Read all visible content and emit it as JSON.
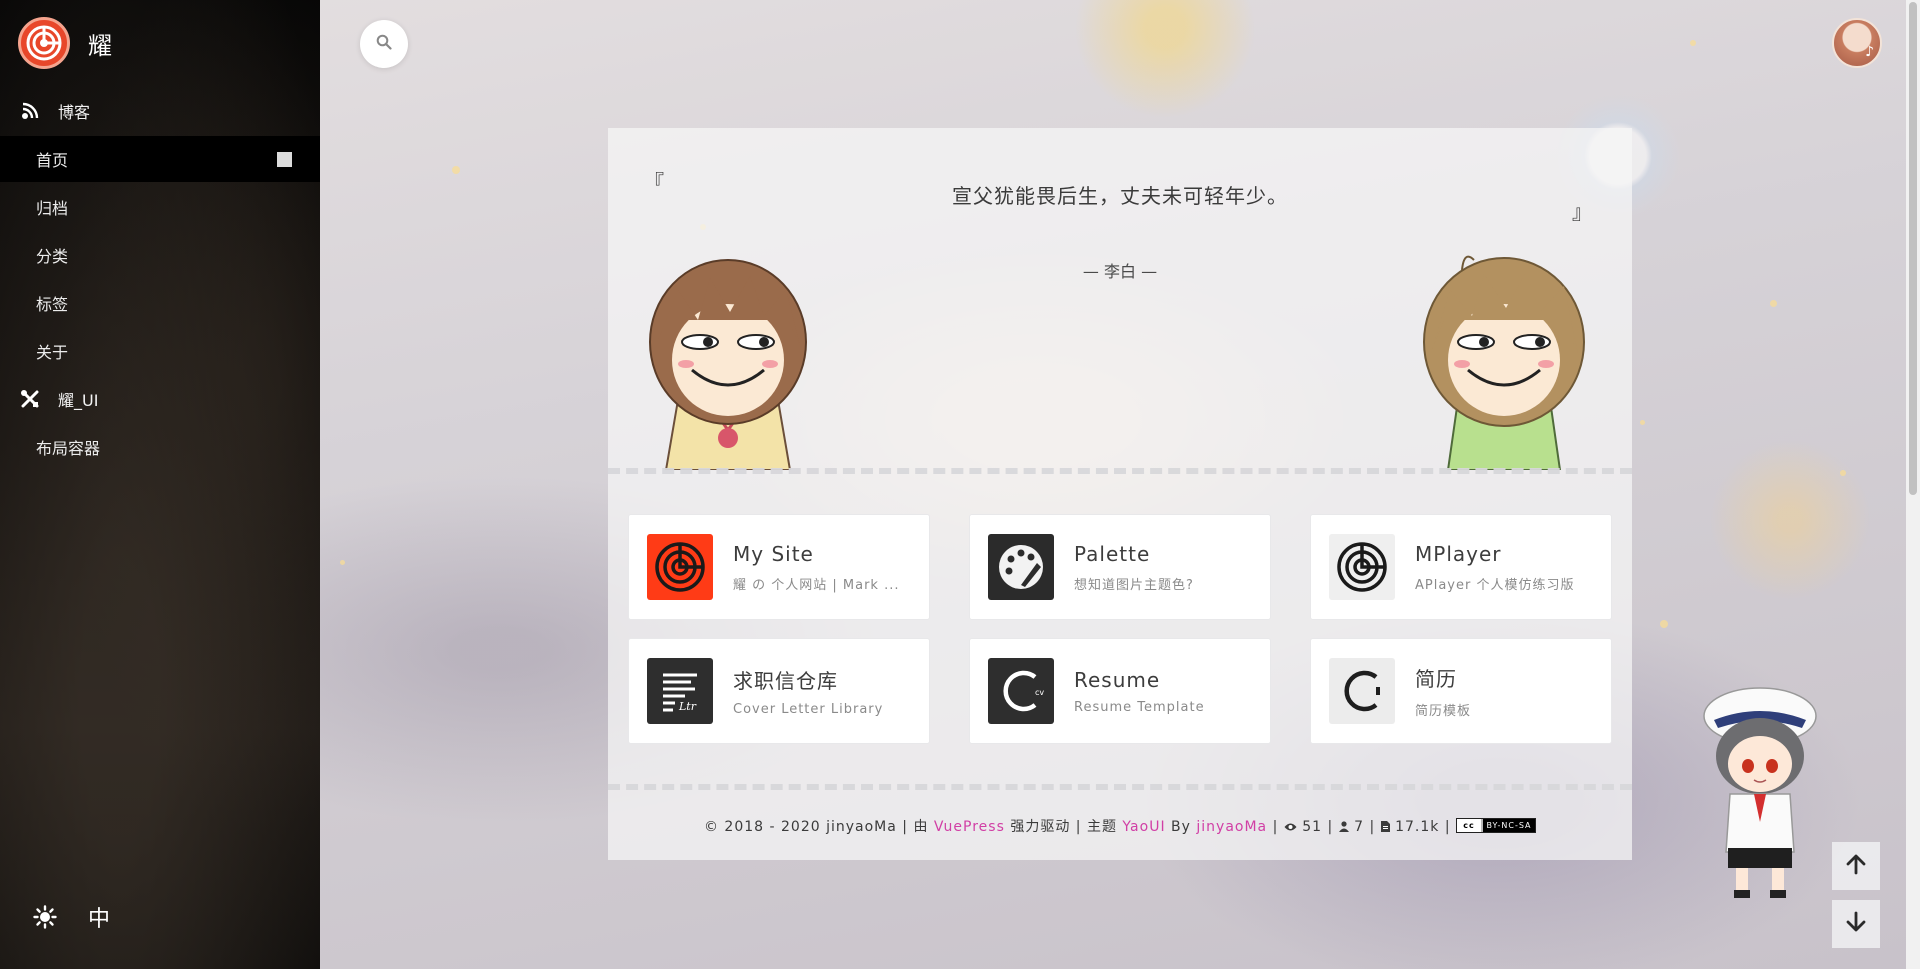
{
  "brand": {
    "title": "耀"
  },
  "sidebar": {
    "groups": [
      {
        "label": "博客",
        "icon": "blog-icon"
      },
      {
        "label": "耀_UI",
        "icon": "tools-icon"
      }
    ],
    "items": [
      {
        "label": "首页",
        "active": true
      },
      {
        "label": "归档"
      },
      {
        "label": "分类"
      },
      {
        "label": "标签"
      },
      {
        "label": "关于"
      },
      {
        "label": "布局容器"
      }
    ],
    "bottom": {
      "theme_icon": "sun-icon",
      "lang_label": "中"
    }
  },
  "search": {
    "icon": "search-icon"
  },
  "quote": {
    "open_mark": "『",
    "text": "宣父犹能畏后生，丈夫未可轻年少。",
    "close_mark": "』",
    "author": "— 李白 —"
  },
  "tiles": [
    {
      "title": "My Site",
      "subtitle": "耀 の 个人网站 | Mark ...",
      "icon": "site-logo-icon",
      "color": "#ff3b16"
    },
    {
      "title": "Palette",
      "subtitle": "想知道图片主题色?",
      "icon": "palette-icon",
      "color": "#2b2b2b"
    },
    {
      "title": "MPlayer",
      "subtitle": "APlayer 个人模仿练习版",
      "icon": "mplayer-logo-icon",
      "color": "#efefef"
    },
    {
      "title": "求职信仓库",
      "subtitle": "Cover Letter Library",
      "icon": "letter-icon",
      "color": "#2e2e2e"
    },
    {
      "title": "Resume",
      "subtitle": "Resume Template",
      "icon": "resume-cv-icon",
      "color": "#2e2e2e"
    },
    {
      "title": "简历",
      "subtitle": "简历模板",
      "icon": "resume-cn-icon",
      "color": "#ececec"
    }
  ],
  "footer": {
    "copyright": "© 2018 - 2020 jinyaoMa",
    "sep": "|",
    "powered_by_prefix": "由",
    "powered_by_link": "VuePress",
    "powered_by_suffix": "强力驱动",
    "theme_prefix": "主题",
    "theme_link": "YaoUI",
    "by": "By",
    "author_link": "jinyaoMa",
    "views": "51",
    "visitors": "7",
    "words": "17.1k",
    "license_left": "cc",
    "license": "BY-NC-SA"
  },
  "colors": {
    "accent": "#d13fa5",
    "sidebar": "#0b0a09",
    "brand": "#e8472a"
  }
}
